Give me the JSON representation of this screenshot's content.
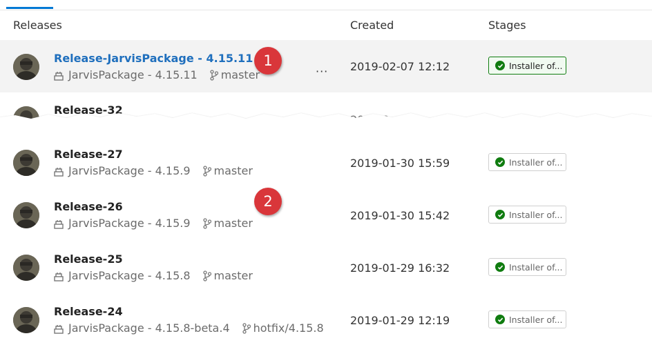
{
  "headers": {
    "releases": "Releases",
    "created": "Created",
    "stages": "Stages"
  },
  "release_rows": [
    {
      "title": "Release-JarvisPackage - 4.15.11",
      "artifact": "JarvisPackage - 4.15.11",
      "branch": "master",
      "created": "2019-02-07 12:12",
      "stage": "Installer of...",
      "selected": true
    },
    {
      "title": "Release-32",
      "artifact": "",
      "branch": "",
      "created": "2019-0",
      "stage": ""
    },
    {
      "title": "Release-27",
      "artifact": "JarvisPackage - 4.15.9",
      "branch": "master",
      "created": "2019-01-30 15:59",
      "stage": "Installer of..."
    },
    {
      "title": "Release-26",
      "artifact": "JarvisPackage - 4.15.9",
      "branch": "master",
      "created": "2019-01-30 15:42",
      "stage": "Installer of..."
    },
    {
      "title": "Release-25",
      "artifact": "JarvisPackage - 4.15.8",
      "branch": "master",
      "created": "2019-01-29 16:32",
      "stage": "Installer of..."
    },
    {
      "title": "Release-24",
      "artifact": "JarvisPackage - 4.15.8-beta.4",
      "branch": "hotfix/4.15.8",
      "created": "2019-01-29 12:19",
      "stage": "Installer of..."
    }
  ],
  "more_actions": "···",
  "callouts": [
    "1",
    "2"
  ],
  "icons": {
    "package": "package-icon",
    "branch": "branch-icon",
    "success": "check-circle-icon",
    "more": "more-icon"
  },
  "colors": {
    "link": "#1f6fbd",
    "success": "#107c10",
    "callout": "#d9363a",
    "selected_row": "#f3f3f3",
    "tab_underline": "#0078d4"
  }
}
